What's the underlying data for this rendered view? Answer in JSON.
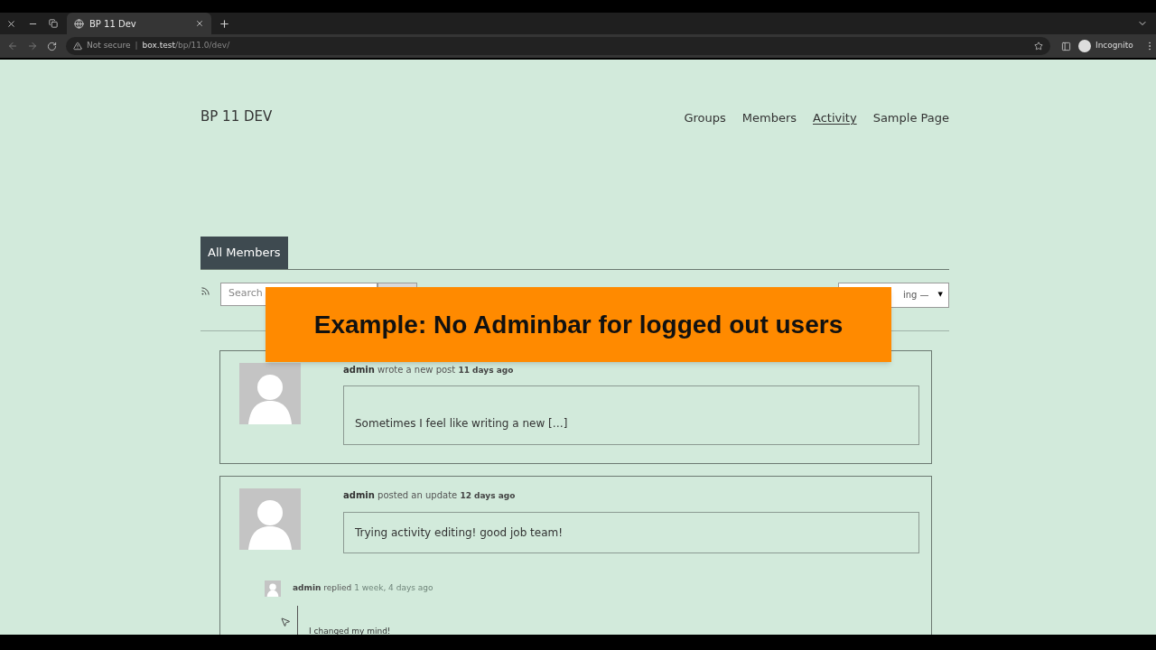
{
  "browser": {
    "tab_title": "BP 11 Dev",
    "security": "Not secure",
    "separator": "|",
    "url_host": "box.test",
    "url_path": "/bp/11.0/dev/",
    "profile": "Incognito"
  },
  "site": {
    "title": "BP 11 DEV",
    "nav": [
      {
        "label": "Groups",
        "selected": false
      },
      {
        "label": "Members",
        "selected": false
      },
      {
        "label": "Activity",
        "selected": true
      },
      {
        "label": "Sample Page",
        "selected": false
      }
    ]
  },
  "tabs": [
    {
      "label": "All Members",
      "selected": true
    }
  ],
  "search": {
    "placeholder": "Search"
  },
  "filter": {
    "value": "ing —",
    "caret": "▼"
  },
  "activities": [
    {
      "user": "admin",
      "action": "wrote a new post",
      "time": "11 days ago",
      "excerpt": "Sometimes I feel like writing a new […]",
      "tall": true
    },
    {
      "user": "admin",
      "action": "posted an update",
      "time": "12 days ago",
      "excerpt": "Trying activity editing! good job team!",
      "tall": false,
      "replies": [
        {
          "user": "admin",
          "action": "replied",
          "time": "1 week, 4 days ago",
          "text": "I changed my mind!"
        }
      ]
    }
  ],
  "caption": "Example: No Adminbar for logged out users"
}
